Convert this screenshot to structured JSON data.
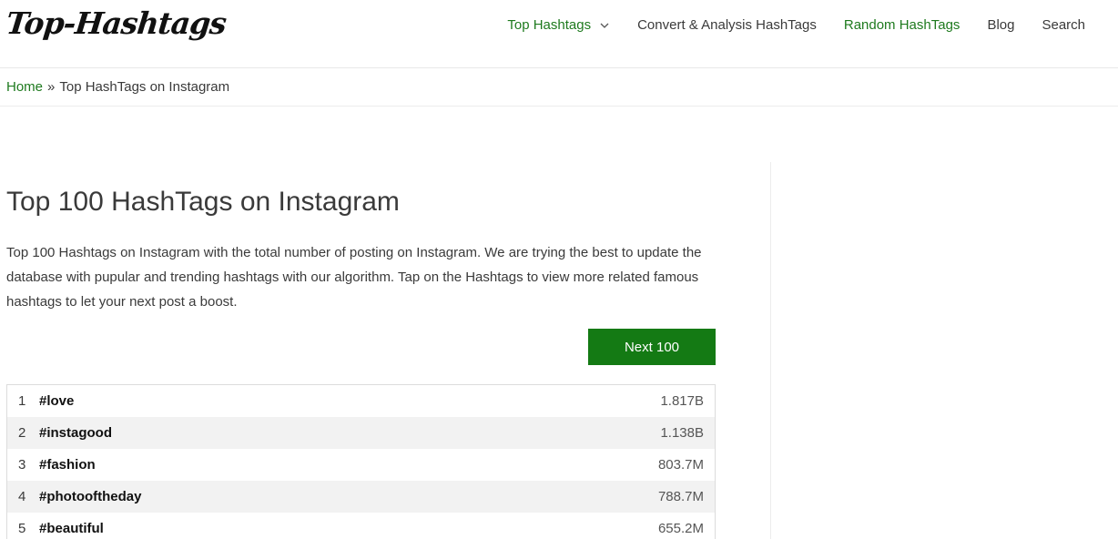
{
  "header": {
    "logo_text": "Top-Hashtags",
    "nav": [
      {
        "label": "Top Hashtags",
        "has_dropdown": true
      },
      {
        "label": "Convert & Analysis HashTags"
      },
      {
        "label": "Random HashTags"
      },
      {
        "label": "Blog"
      },
      {
        "label": "Search"
      }
    ]
  },
  "breadcrumb": {
    "home": "Home",
    "separator": "»",
    "current": "Top HashTags on Instagram"
  },
  "main": {
    "title": "Top 100 HashTags on Instagram",
    "description": "Top 100 Hashtags on Instagram with the total number of posting on Instagram. We are trying the best to update the database with pupular and trending hashtags with our algorithm. Tap on the Hashtags to view more related famous hashtags to let your next post a boost.",
    "next_button": "Next 100",
    "hashtags": [
      {
        "rank": "1",
        "tag": "#love",
        "count": "1.817B"
      },
      {
        "rank": "2",
        "tag": "#instagood",
        "count": "1.138B"
      },
      {
        "rank": "3",
        "tag": "#fashion",
        "count": "803.7M"
      },
      {
        "rank": "4",
        "tag": "#photooftheday",
        "count": "788.7M"
      },
      {
        "rank": "5",
        "tag": "#beautiful",
        "count": "655.2M"
      }
    ]
  },
  "colors": {
    "accent_green": "#1e7a1e",
    "button_green": "#147a14"
  }
}
